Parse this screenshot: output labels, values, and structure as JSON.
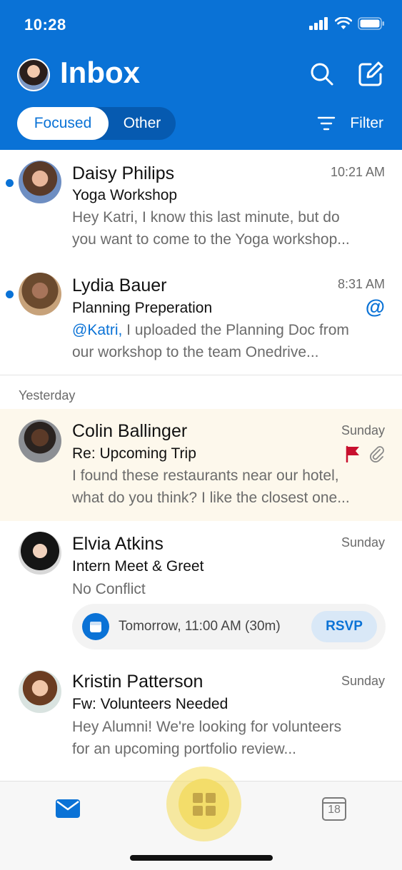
{
  "status_bar": {
    "time": "10:28"
  },
  "header": {
    "title": "Inbox",
    "tabs": {
      "focused": "Focused",
      "other": "Other"
    },
    "filter_label": "Filter"
  },
  "messages": [
    {
      "sender": "Daisy Philips",
      "time": "10:21 AM",
      "subject": "Yoga Workshop",
      "preview_line1": "Hey Katri, I know this last minute, but do",
      "preview_line2": "you want to come to the Yoga workshop...",
      "unread": true
    },
    {
      "sender": "Lydia Bauer",
      "time": "8:31 AM",
      "subject": "Planning Preperation",
      "mention": "@Katri,",
      "preview_line1": " I uploaded the Planning Doc from",
      "preview_line2": "our workshop to the team Onedrive...",
      "unread": true,
      "mention_icon": "@"
    },
    {
      "sender": "Colin Ballinger",
      "time": "Sunday",
      "subject": "Re: Upcoming Trip",
      "preview_line1": "I found these restaurants near our hotel,",
      "preview_line2": "what do you think? I like the closest one...",
      "flagged": true,
      "attachment": true
    },
    {
      "sender": "Elvia Atkins",
      "time": "Sunday",
      "subject": "Intern Meet & Greet",
      "preview_line1": "No Conflict",
      "event": {
        "time": "Tomorrow, 11:00 AM (30m)",
        "rsvp_label": "RSVP"
      }
    },
    {
      "sender": "Kristin Patterson",
      "time": "Sunday",
      "subject": "Fw: Volunteers Needed",
      "preview_line1": "Hey Alumni! We're looking for volunteers",
      "preview_line2": "for an upcoming portfolio review..."
    }
  ],
  "sections": {
    "yesterday": "Yesterday"
  },
  "bottom_nav": {
    "calendar_day": "18"
  },
  "colors": {
    "brand": "#0a72d6",
    "highlight_row": "#fdf8ec",
    "flag": "#c8102e",
    "apps_button": "#f3dd6a"
  }
}
